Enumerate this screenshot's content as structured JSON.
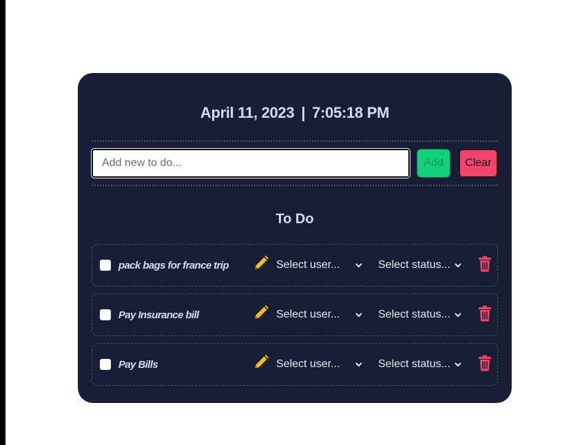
{
  "header": {
    "date": "April 11, 2023",
    "separator": "|",
    "time": "7:05:18 PM"
  },
  "new_todo": {
    "placeholder": "Add new to do...",
    "value": "",
    "add_label": "Add",
    "clear_label": "Clear"
  },
  "section": {
    "title": "To Do"
  },
  "todos": [
    {
      "text": "pack bags for france trip",
      "checked": false,
      "user_select": "Select user...",
      "status_select": "Select status..."
    },
    {
      "text": "Pay Insurance bill",
      "checked": false,
      "user_select": "Select user...",
      "status_select": "Select status..."
    },
    {
      "text": "Pay Bills",
      "checked": false,
      "user_select": "Select user...",
      "status_select": "Select status..."
    }
  ],
  "icons": {
    "edit": "pencil-icon",
    "delete": "trash-icon",
    "dropdown": "chevron-down-icon"
  },
  "colors": {
    "card_bg": "#181e36",
    "add_button": "#14d07a",
    "clear_button": "#f2456e",
    "edit_icon": "#f5c400",
    "delete_icon": "#f2456e",
    "item_border": "#2b5e5e"
  }
}
